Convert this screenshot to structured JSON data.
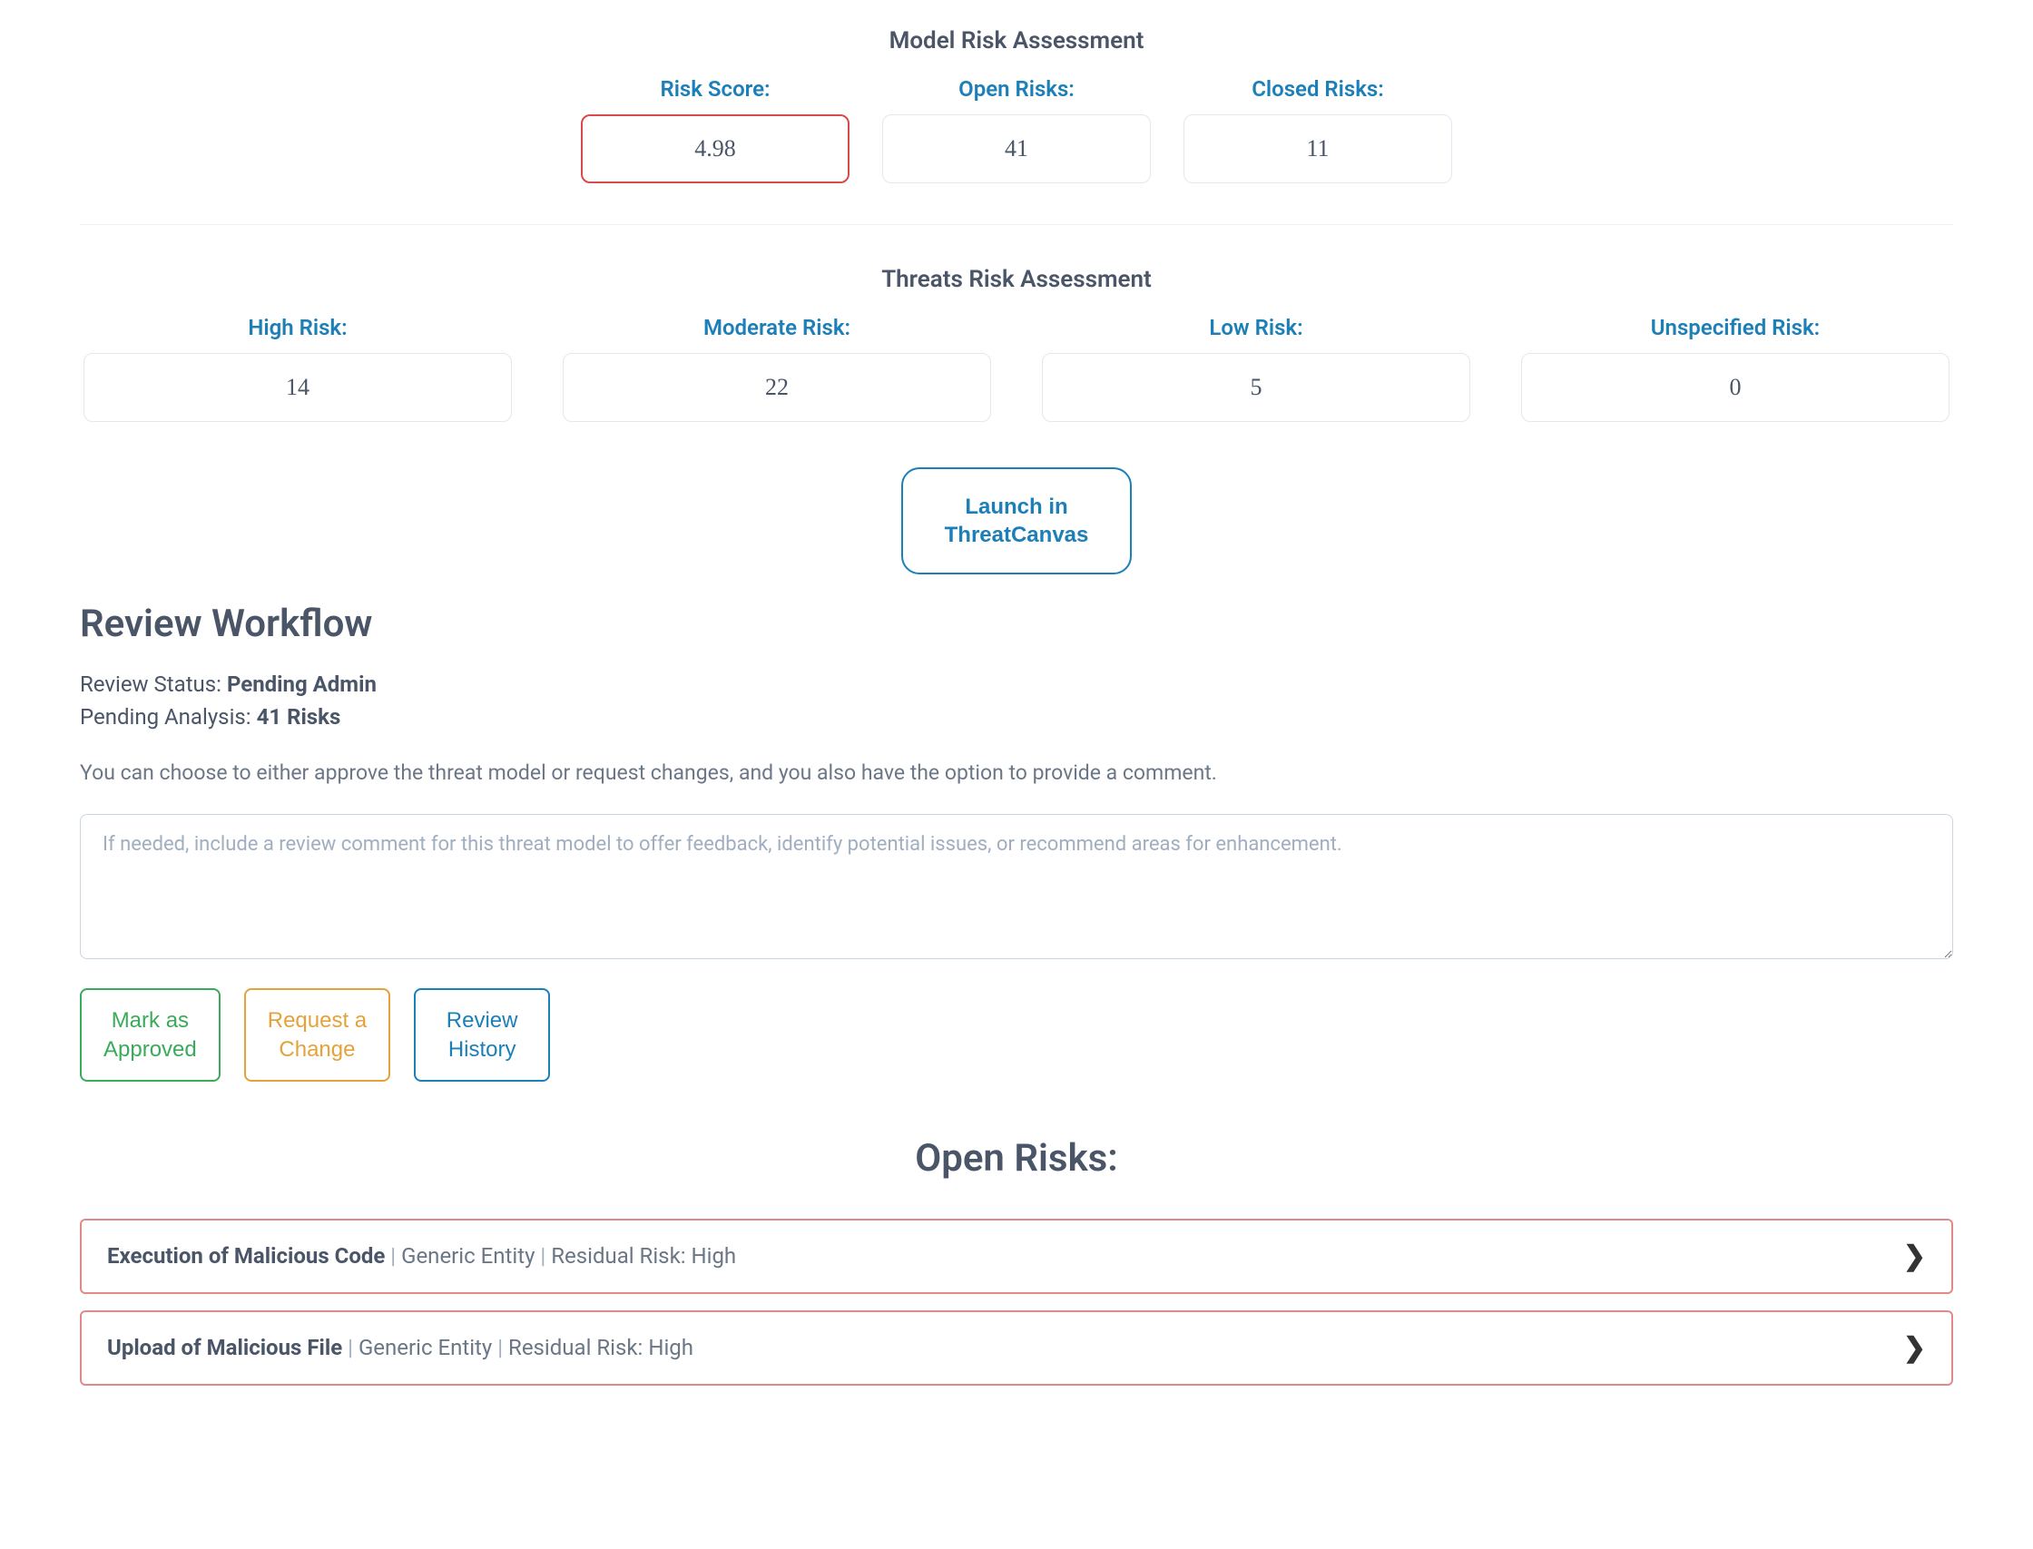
{
  "model_assessment": {
    "title": "Model Risk Assessment",
    "risk_score": {
      "label": "Risk Score:",
      "value": "4.98"
    },
    "open_risks": {
      "label": "Open Risks:",
      "value": "41"
    },
    "closed_risks": {
      "label": "Closed Risks:",
      "value": "11"
    }
  },
  "threats_assessment": {
    "title": "Threats Risk Assessment",
    "high": {
      "label": "High Risk:",
      "value": "14"
    },
    "moderate": {
      "label": "Moderate Risk:",
      "value": "22"
    },
    "low": {
      "label": "Low Risk:",
      "value": "5"
    },
    "unspecified": {
      "label": "Unspecified Risk:",
      "value": "0"
    }
  },
  "launch_button_l1": "Launch in",
  "launch_button_l2": "ThreatCanvas",
  "review": {
    "heading": "Review Workflow",
    "status_label": "Review Status: ",
    "status_value": "Pending Admin",
    "pending_label": "Pending Analysis: ",
    "pending_value": "41 Risks",
    "description": "You can choose to either approve the threat model or request changes, and you also have the option to provide a comment.",
    "comment_placeholder": "If needed, include a review comment for this threat model to offer feedback, identify potential issues, or recommend areas for enhancement.",
    "comment_value": "",
    "mark_approved_l1": "Mark as",
    "mark_approved_l2": "Approved",
    "request_change_l1": "Request a",
    "request_change_l2": "Change",
    "review_history_l1": "Review",
    "review_history_l2": "History"
  },
  "open_risks_section": {
    "title": "Open Risks:",
    "items": [
      {
        "name": "Execution of Malicious Code",
        "entity": "Generic Entity",
        "risk_label": "Residual Risk:",
        "risk_level": "High"
      },
      {
        "name": "Upload of Malicious File",
        "entity": "Generic Entity",
        "risk_label": "Residual Risk:",
        "risk_level": "High"
      }
    ]
  }
}
